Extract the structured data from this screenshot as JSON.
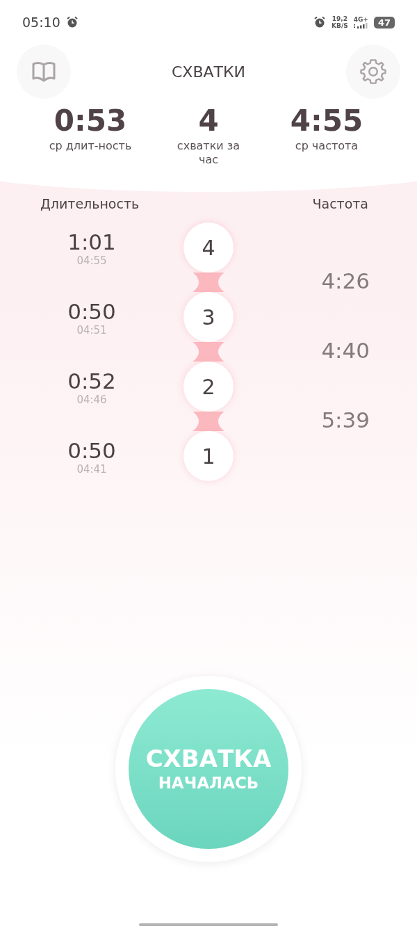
{
  "status_bar": {
    "time": "05:10",
    "speed_value": "19,2",
    "speed_unit": "KB/S",
    "network": "4G+",
    "battery": "47"
  },
  "header": {
    "title": "СХВАТКИ"
  },
  "stats": [
    {
      "value": "0:53",
      "label": "ср длит-ность"
    },
    {
      "value": "4",
      "label": "схватки за час"
    },
    {
      "value": "4:55",
      "label": "ср частота"
    }
  ],
  "columns": {
    "duration": "Длительность",
    "frequency": "Частота"
  },
  "contractions": [
    {
      "duration": "1:01",
      "start": "04:55",
      "number": "4"
    },
    {
      "duration": "0:50",
      "start": "04:51",
      "number": "3"
    },
    {
      "duration": "0:52",
      "start": "04:46",
      "number": "2"
    },
    {
      "duration": "0:50",
      "start": "04:41",
      "number": "1"
    }
  ],
  "frequencies": [
    "4:26",
    "4:40",
    "5:39"
  ],
  "start_button": {
    "line_1": "СХВАТКА",
    "line_2": "НАЧАЛАСЬ"
  }
}
